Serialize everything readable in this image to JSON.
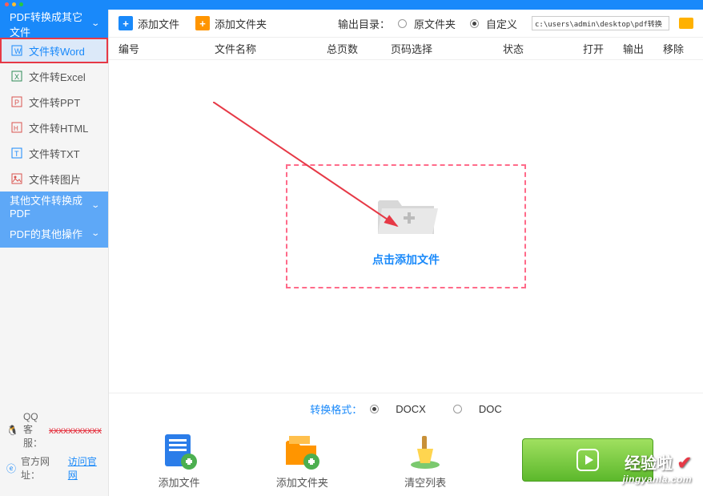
{
  "sidebar": {
    "section1": {
      "title": "PDF转换成其它文件"
    },
    "section2": {
      "title": "其他文件转换成PDF"
    },
    "section3": {
      "title": "PDF的其他操作"
    },
    "items": [
      {
        "label": "文件转Word",
        "color": "#1989fa"
      },
      {
        "label": "文件转Excel",
        "color": "#2e8b57"
      },
      {
        "label": "文件转PPT",
        "color": "#d9534f"
      },
      {
        "label": "文件转HTML",
        "color": "#d9534f"
      },
      {
        "label": "文件转TXT",
        "color": "#1989fa"
      },
      {
        "label": "文件转图片",
        "color": "#d9534f"
      }
    ]
  },
  "toolbar": {
    "add_file": "添加文件",
    "add_folder": "添加文件夹",
    "output_label": "输出目录：",
    "radio_original": "原文件夹",
    "radio_custom": "自定义",
    "path": "c:\\users\\admin\\desktop\\pdf转换"
  },
  "columns": {
    "c1": "编号",
    "c2": "文件名称",
    "c3": "总页数",
    "c4": "页码选择",
    "c5": "状态",
    "c6": "打开",
    "c7": "输出",
    "c8": "移除"
  },
  "drop": {
    "label": "点击添加文件"
  },
  "format": {
    "label": "转换格式：",
    "docx": "DOCX",
    "doc": "DOC"
  },
  "actions": {
    "add_file": "添加文件",
    "add_folder": "添加文件夹",
    "clear": "清空列表"
  },
  "footer": {
    "qq_label": "QQ 客服：",
    "qq_value": "xxxxxxxxxxx",
    "site_label": "官方网址：",
    "site_link": "访问官网"
  },
  "watermark": {
    "top": "经验啦",
    "bottom": "jingyanla.com"
  }
}
